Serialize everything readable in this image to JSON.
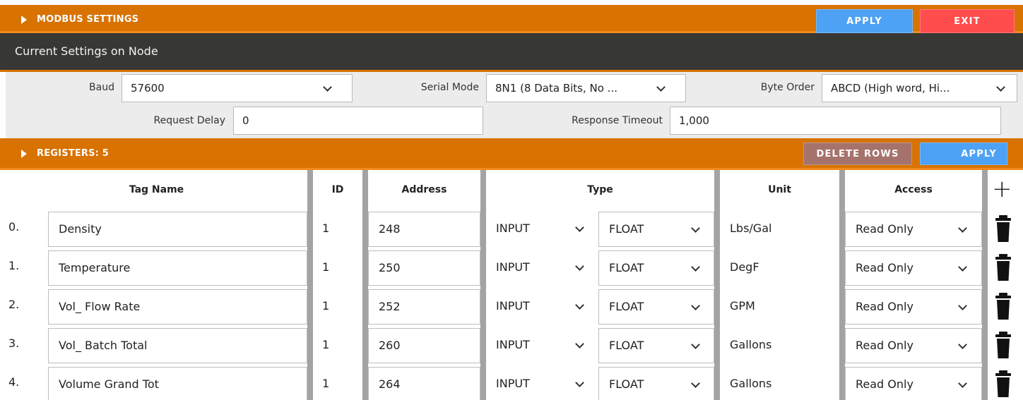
{
  "modbus": {
    "title": "MODBUS SETTINGS",
    "apply_label": "APPLY",
    "exit_label": "EXIT"
  },
  "current_settings": {
    "title": "Current Settings on Node"
  },
  "settings": {
    "baud_label": "Baud",
    "baud_value": "57600",
    "serial_mode_label": "Serial Mode",
    "serial_mode_value": "8N1 (8 Data Bits, No ...",
    "byte_order_label": "Byte Order",
    "byte_order_value": "ABCD (High word, Hi...",
    "request_delay_label": "Request Delay",
    "request_delay_value": "0",
    "response_timeout_label": "Response Timeout",
    "response_timeout_value": "1,000"
  },
  "registers": {
    "title": "REGISTERS: 5",
    "delete_label": "DELETE ROWS",
    "apply_label": "APPLY",
    "headers": [
      "Tag Name",
      "ID",
      "Address",
      "Type",
      "Unit",
      "Access"
    ],
    "rows": [
      {
        "index": "0.",
        "tag": "Density",
        "id": "1",
        "address": "248",
        "type": "INPUT",
        "format": "FLOAT",
        "unit": "Lbs/Gal",
        "access": "Read Only"
      },
      {
        "index": "1.",
        "tag": "Temperature",
        "id": "1",
        "address": "250",
        "type": "INPUT",
        "format": "FLOAT",
        "unit": "DegF",
        "access": "Read Only"
      },
      {
        "index": "2.",
        "tag": "Vol_ Flow Rate",
        "id": "1",
        "address": "252",
        "type": "INPUT",
        "format": "FLOAT",
        "unit": "GPM",
        "access": "Read Only"
      },
      {
        "index": "3.",
        "tag": "Vol_ Batch Total",
        "id": "1",
        "address": "260",
        "type": "INPUT",
        "format": "FLOAT",
        "unit": "Gallons",
        "access": "Read Only"
      },
      {
        "index": "4.",
        "tag": "Volume Grand Tot",
        "id": "1",
        "address": "264",
        "type": "INPUT",
        "format": "FLOAT",
        "unit": "Gallons",
        "access": "Read Only"
      }
    ]
  },
  "icons": {
    "expand": "triangle-right-icon",
    "dropdown": "chevron-down-icon",
    "add": "plus-icon",
    "delete": "trash-icon"
  },
  "colors": {
    "orange": "#d87200",
    "dark_bar": "#373734",
    "blue_button": "#4da2f5",
    "red_button": "#ff4c4c",
    "delete_button": "#a5736c"
  }
}
